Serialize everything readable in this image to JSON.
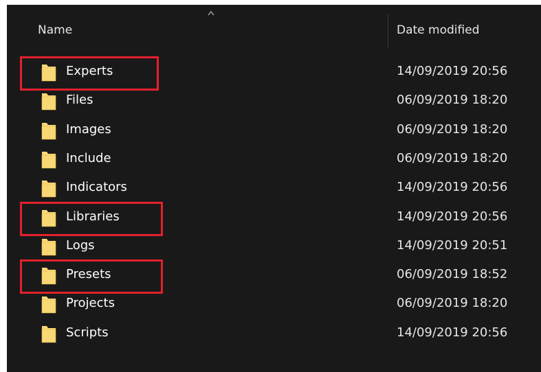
{
  "header": {
    "name_label": "Name",
    "date_label": "Date modified",
    "sort_icon": "chevron-up-icon"
  },
  "files": [
    {
      "name": "Experts",
      "date": "14/09/2019 20:56",
      "highlighted": true
    },
    {
      "name": "Files",
      "date": "06/09/2019 18:20",
      "highlighted": false
    },
    {
      "name": "Images",
      "date": "06/09/2019 18:20",
      "highlighted": false
    },
    {
      "name": "Include",
      "date": "06/09/2019 18:20",
      "highlighted": false
    },
    {
      "name": "Indicators",
      "date": "14/09/2019 20:56",
      "highlighted": false
    },
    {
      "name": "Libraries",
      "date": "14/09/2019 20:56",
      "highlighted": true
    },
    {
      "name": "Logs",
      "date": "14/09/2019 20:51",
      "highlighted": false
    },
    {
      "name": "Presets",
      "date": "06/09/2019 18:52",
      "highlighted": true
    },
    {
      "name": "Projects",
      "date": "06/09/2019 18:20",
      "highlighted": false
    },
    {
      "name": "Scripts",
      "date": "14/09/2019 20:56",
      "highlighted": false
    }
  ],
  "colors": {
    "background": "#191919",
    "folder": "#f8d775",
    "highlight": "#e4202c",
    "text": "#ffffff"
  }
}
